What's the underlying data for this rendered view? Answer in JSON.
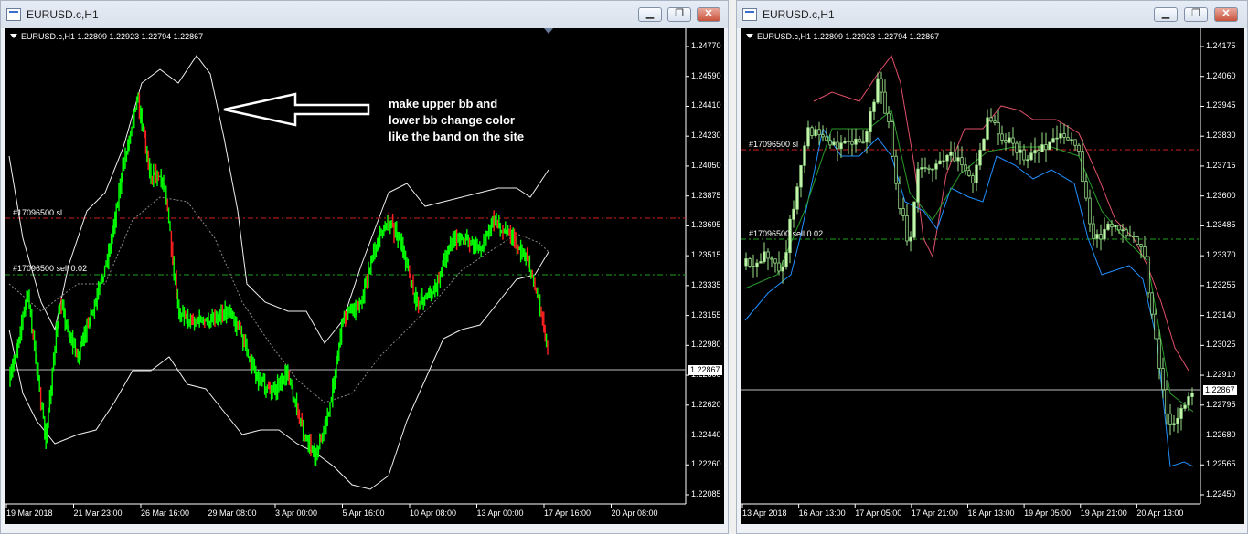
{
  "left": {
    "title": "EURUSD.c,H1",
    "header": "EURUSD.c,H1  1.22809 1.22923 1.22794 1.22867",
    "prices": [
      "1.24770",
      "1.24590",
      "1.24410",
      "1.24230",
      "1.24050",
      "1.23875",
      "1.23695",
      "1.23515",
      "1.23335",
      "1.23155",
      "1.22980",
      "1.22800",
      "1.22620",
      "1.22440",
      "1.22260",
      "1.22085"
    ],
    "current_price": "1.22867",
    "dates": [
      "19 Mar 2018",
      "21 Mar 23:00",
      "26 Mar 16:00",
      "29 Mar 08:00",
      "3 Apr 00:00",
      "5 Apr 16:00",
      "10 Apr 08:00",
      "13 Apr 00:00",
      "17 Apr 16:00",
      "20 Apr 08:00"
    ],
    "sl_label": "#17096500 sl",
    "sell_label": "#17096500 sell 0.02",
    "annotation": [
      "make upper bb and",
      "lower bb change color",
      "like the band on the site"
    ]
  },
  "right": {
    "title": "EURUSD.c,H1",
    "header": "EURUSD.c,H1  1.22809 1.22923 1.22794 1.22867",
    "prices": [
      "1.24175",
      "1.24060",
      "1.23945",
      "1.23830",
      "1.23715",
      "1.23600",
      "1.23485",
      "1.23370",
      "1.23255",
      "1.23140",
      "1.23025",
      "1.22910",
      "1.22795",
      "1.22680",
      "1.22565",
      "1.22450"
    ],
    "current_price": "1.22867",
    "dates": [
      "13 Apr 2018",
      "16 Apr 13:00",
      "17 Apr 05:00",
      "17 Apr 21:00",
      "18 Apr 13:00",
      "19 Apr 05:00",
      "19 Apr 21:00",
      "20 Apr 13:00"
    ],
    "sl_label": "#17096500 sl",
    "sell_label": "#17096500 sell 0.02"
  },
  "controls": {
    "minimize": "▁",
    "restore": "❐",
    "close": "✕"
  },
  "colors": {
    "bull": "#00ff00",
    "bear": "#ff2020",
    "bb": "#f0f0f0",
    "sl_line": "#d02020",
    "entry_line": "#1fa01f",
    "upper_band": "#e0506a",
    "lower_band": "#2090ff",
    "mid_band": "#2a9a2a"
  }
}
